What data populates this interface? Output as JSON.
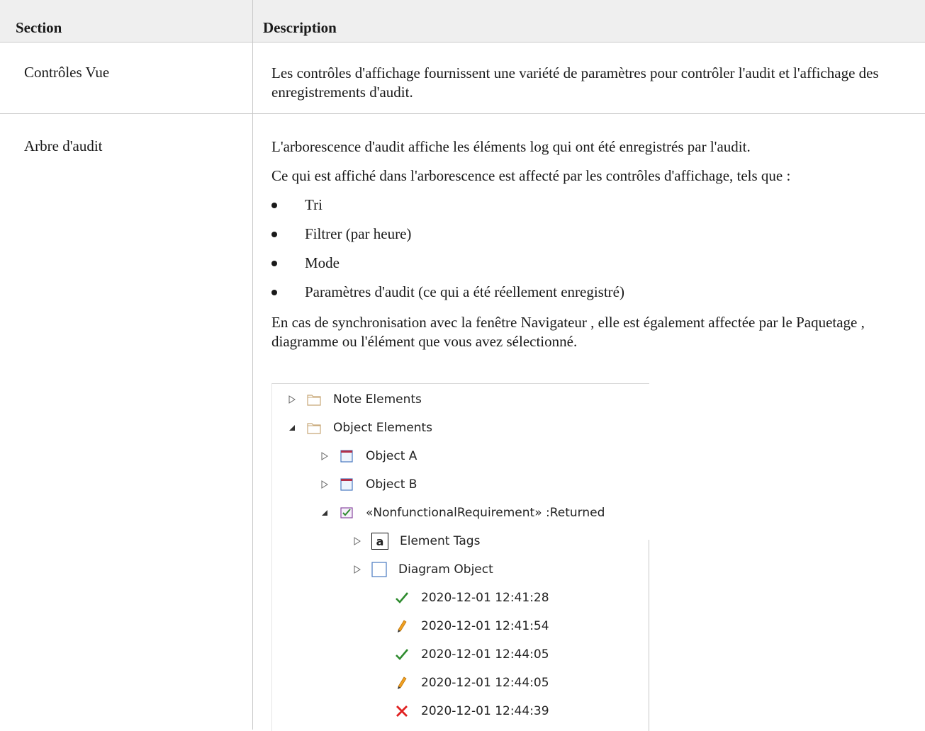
{
  "header": {
    "section": "Section",
    "description": "Description"
  },
  "rows": [
    {
      "section": "Contrôles Vue",
      "description": "Les contrôles d'affichage fournissent une variété de paramètres pour contrôler l'audit et l'affichage des enregistrements d'audit."
    },
    {
      "section": "Arbre d'audit",
      "p1": "L'arborescence d'audit affiche les éléments log qui ont été enregistrés par l'audit.",
      "p2": "Ce qui est affiché dans l'arborescence est affecté par les contrôles d'affichage, tels que :",
      "bullets": [
        "Tri",
        "Filtrer (par heure)",
        "Mode",
        "Paramètres d'audit (ce qui a été réellement enregistré)"
      ],
      "p3": "En cas de synchronisation avec la fenêtre Navigateur , elle est également affectée par le Paquetage , diagramme ou l'élément que vous avez sélectionné."
    }
  ],
  "tree": {
    "items": [
      {
        "label": "Note Elements",
        "icon": "folder-icon",
        "expanded": false
      },
      {
        "label": "Object Elements",
        "icon": "folder-icon",
        "expanded": true
      },
      {
        "label": "Object A",
        "icon": "object-icon",
        "expanded": false
      },
      {
        "label": "Object B",
        "icon": "object-icon",
        "expanded": false
      },
      {
        "label": "«NonfunctionalRequirement» :Returned",
        "icon": "requirement-icon",
        "expanded": true
      },
      {
        "label": "Element Tags",
        "icon": "tag-icon",
        "expanded": false
      },
      {
        "label": "Diagram Object",
        "icon": "diagram-object-icon",
        "expanded": false
      },
      {
        "label": "2020-12-01 12:41:28",
        "icon": "check-icon"
      },
      {
        "label": "2020-12-01 12:41:54",
        "icon": "pencil-icon"
      },
      {
        "label": "2020-12-01 12:44:05",
        "icon": "check-icon"
      },
      {
        "label": "2020-12-01 12:44:05",
        "icon": "pencil-icon"
      },
      {
        "label": "2020-12-01 12:44:39",
        "icon": "cross-icon"
      }
    ],
    "tag_glyph": "a"
  },
  "colors": {
    "header_bg": "#efefef",
    "grid": "#c8c8c8",
    "check": "#2e8b2e",
    "cross": "#e02020",
    "pencil": "#f0a020",
    "folder": "#c8a878"
  }
}
